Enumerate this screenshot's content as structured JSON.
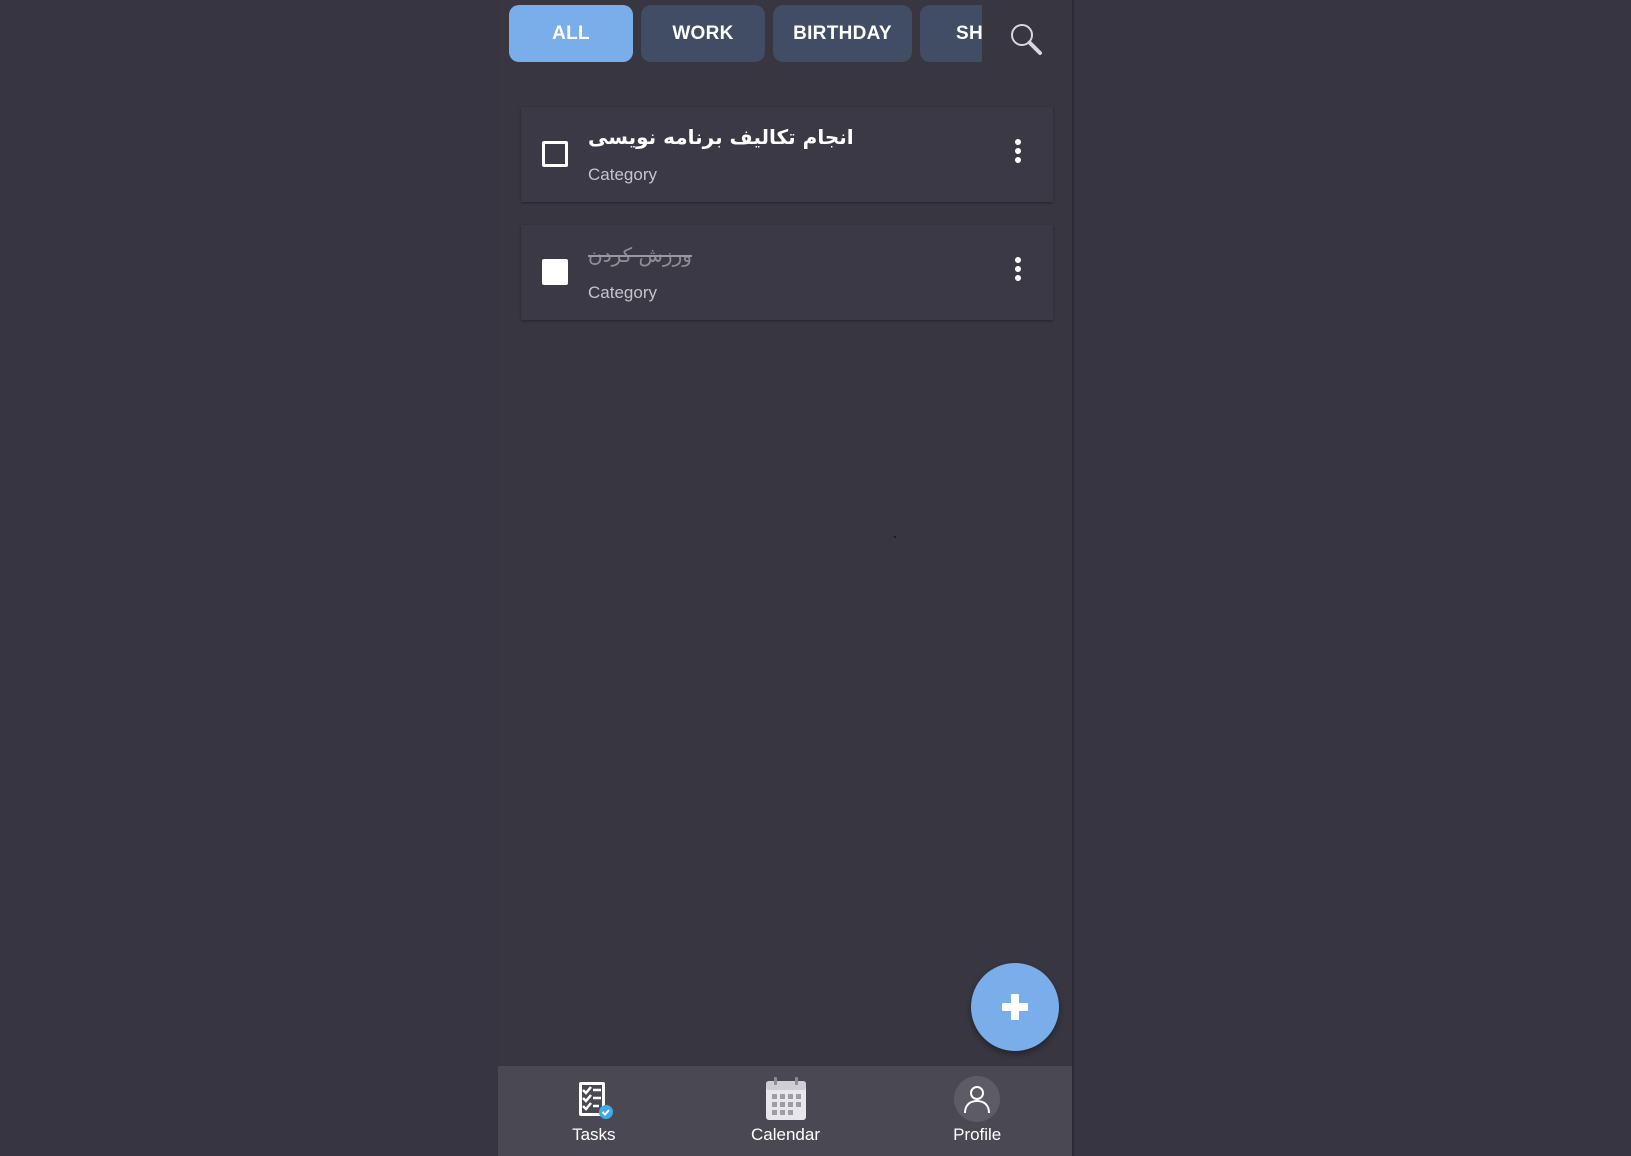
{
  "categories": {
    "items": [
      {
        "label": "ALL",
        "active": true
      },
      {
        "label": "WORK",
        "active": false
      },
      {
        "label": "BIRTHDAY",
        "active": false
      },
      {
        "label": "SHOPPING",
        "active": false
      }
    ],
    "visible_text": [
      "ALL",
      "WORK",
      "BIRTHDAY",
      "SH"
    ]
  },
  "search": {
    "icon": "search-icon"
  },
  "tasks": [
    {
      "title": "انجام تکالیف برنامه نویسی",
      "category": "Category",
      "completed": false
    },
    {
      "title": "ورزش کردن",
      "category": "Category",
      "completed": true
    }
  ],
  "fab": {
    "icon": "plus-icon"
  },
  "bottom_nav": {
    "items": [
      {
        "label": "Tasks",
        "icon": "tasks-checklist-icon"
      },
      {
        "label": "Calendar",
        "icon": "calendar-icon"
      },
      {
        "label": "Profile",
        "icon": "profile-icon"
      }
    ]
  },
  "colors": {
    "background": "#363541",
    "chip": "#414c65",
    "chip_active": "#7aaeea",
    "card": "#3a3945",
    "nav_bar": "#4a4953",
    "fab": "#7aaeea"
  }
}
